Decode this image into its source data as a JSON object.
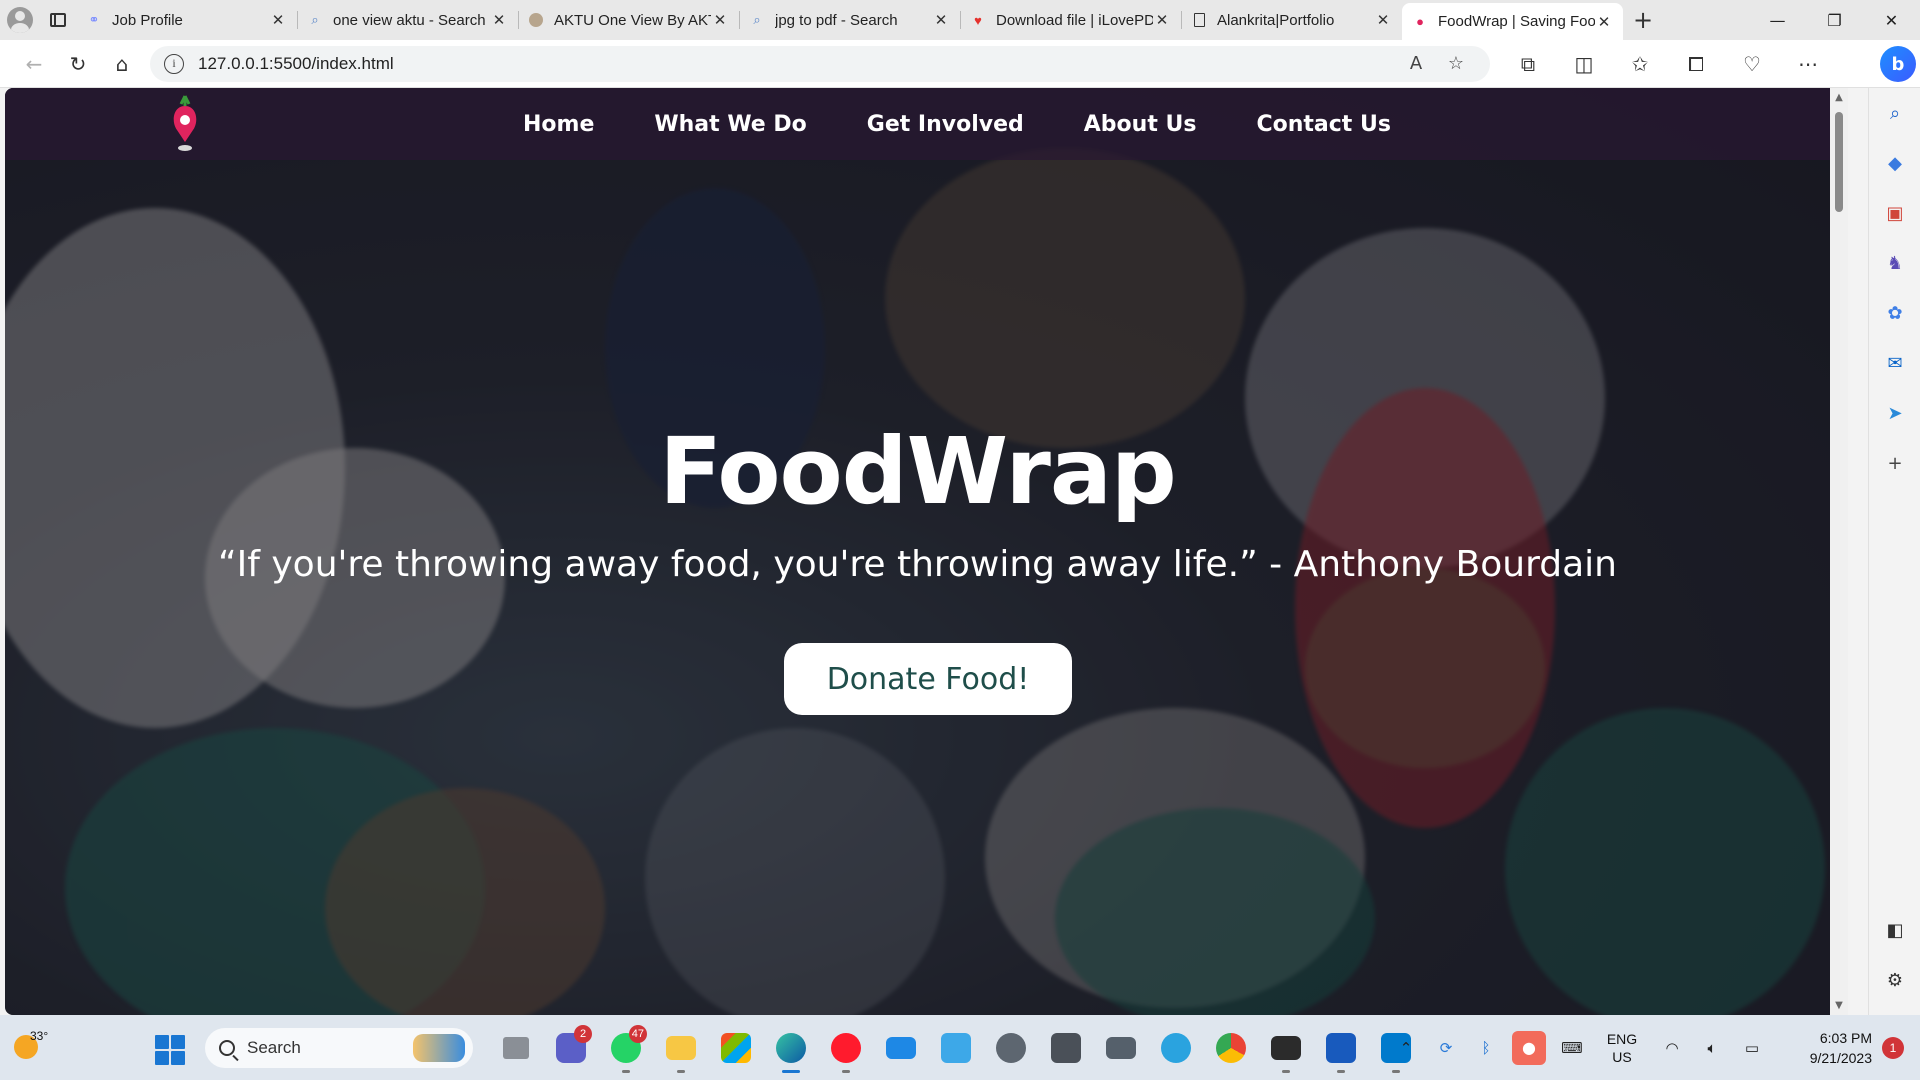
{
  "browser": {
    "tabs": [
      {
        "title": "Job Profile",
        "icon": "job-profile-icon",
        "active": false
      },
      {
        "title": "one view aktu - Search",
        "icon": "search-icon",
        "active": false
      },
      {
        "title": "AKTU One View By AKTU",
        "icon": "aktu-icon",
        "active": false
      },
      {
        "title": "jpg to pdf - Search",
        "icon": "search-icon",
        "active": false
      },
      {
        "title": "Download file | iLovePDF",
        "icon": "ilovepdf-icon",
        "active": false
      },
      {
        "title": "Alankrita|Portfolio",
        "icon": "document-icon",
        "active": false
      },
      {
        "title": "FoodWrap | Saving Food",
        "icon": "foodwrap-icon",
        "active": true
      }
    ],
    "url": "127.0.0.1:5500/index.html"
  },
  "site": {
    "nav": [
      "Home",
      "What We Do",
      "Get Involved",
      "About Us",
      "Contact Us"
    ],
    "hero_title": "FoodWrap",
    "hero_quote": "“If you're throwing away food, you're throwing away life.” - Anthony Bourdain",
    "cta_label": "Donate Food!"
  },
  "taskbar": {
    "weather_temp": "33°",
    "search_label": "Search",
    "teams_badge": "2",
    "whatsapp_badge": "47",
    "lang_line1": "ENG",
    "lang_line2": "US",
    "time": "6:03 PM",
    "date": "9/21/2023",
    "notification_count": "1"
  },
  "colors": {
    "nav_bg": "#2b1a35",
    "cta_text": "#1f4e4a",
    "accent": "#1976d2"
  }
}
